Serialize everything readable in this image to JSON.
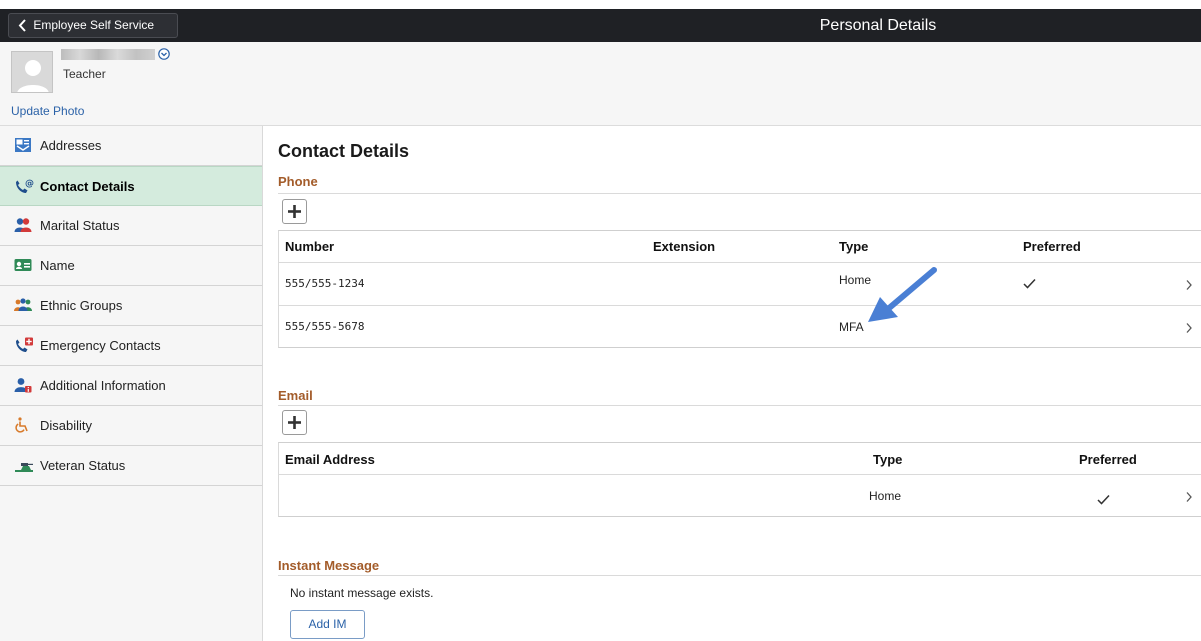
{
  "topbar": {
    "back_label": "Employee Self Service",
    "title": "Personal Details"
  },
  "profile": {
    "job_title": "Teacher",
    "update_photo": "Update Photo"
  },
  "sidebar": {
    "items": [
      {
        "label": "Addresses",
        "icon": "addresses-icon",
        "active": false
      },
      {
        "label": "Contact Details",
        "icon": "contact-details-icon",
        "active": true
      },
      {
        "label": "Marital Status",
        "icon": "marital-status-icon",
        "active": false
      },
      {
        "label": "Name",
        "icon": "name-card-icon",
        "active": false
      },
      {
        "label": "Ethnic Groups",
        "icon": "ethnic-groups-icon",
        "active": false
      },
      {
        "label": "Emergency Contacts",
        "icon": "emergency-contacts-icon",
        "active": false
      },
      {
        "label": "Additional Information",
        "icon": "additional-info-icon",
        "active": false
      },
      {
        "label": "Disability",
        "icon": "disability-icon",
        "active": false
      },
      {
        "label": "Veteran Status",
        "icon": "veteran-status-icon",
        "active": false
      }
    ]
  },
  "main": {
    "title": "Contact Details",
    "phone": {
      "title": "Phone",
      "columns": [
        "Number",
        "Extension",
        "Type",
        "Preferred"
      ],
      "rows": [
        {
          "number": "555/555-1234",
          "extension": "",
          "type": "Home",
          "preferred": true
        },
        {
          "number": "555/555-5678",
          "extension": "",
          "type": "MFA",
          "preferred": false
        }
      ]
    },
    "email": {
      "title": "Email",
      "columns": [
        "Email Address",
        "Type",
        "Preferred"
      ],
      "rows": [
        {
          "address": "",
          "type": "Home",
          "preferred": true
        }
      ]
    },
    "instant_message": {
      "title": "Instant Message",
      "empty_text": "No instant message exists.",
      "add_label": "Add IM"
    }
  },
  "colors": {
    "topbar_bg": "#1f2125",
    "active_nav_bg": "#d4ebdd",
    "group_title": "#a35c2a",
    "link": "#2b62a8",
    "annotation_arrow": "#4a7fd4"
  }
}
